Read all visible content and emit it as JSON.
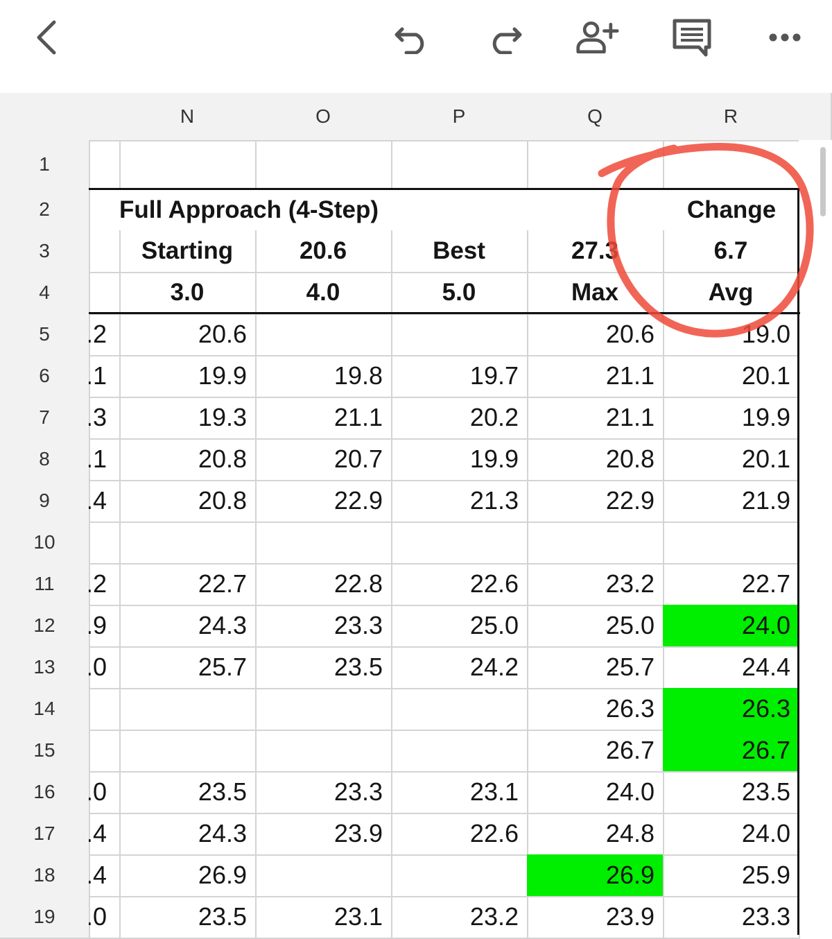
{
  "toolbar": {
    "icons": [
      "back-icon",
      "undo-icon",
      "redo-icon",
      "add-person-icon",
      "comment-icon",
      "more-icon"
    ]
  },
  "columns": [
    "N",
    "O",
    "P",
    "Q",
    "R"
  ],
  "row_numbers": [
    "1",
    "2",
    "3",
    "4",
    "5",
    "6",
    "7",
    "8",
    "9",
    "10",
    "11",
    "12",
    "13",
    "14",
    "15",
    "16",
    "17",
    "18",
    "19"
  ],
  "header": {
    "r2_title": "Full Approach (4-Step)",
    "r2_change": "Change",
    "r3": [
      "Starting",
      "20.6",
      "Best",
      "27.3",
      "6.7"
    ],
    "r4": [
      "3.0",
      "4.0",
      "5.0",
      "Max",
      "Avg"
    ]
  },
  "rows": [
    {
      "row": "5",
      "m": ".2",
      "n": "20.6",
      "o": "",
      "p": "",
      "q": "20.6",
      "r": "19.0"
    },
    {
      "row": "6",
      "m": ".1",
      "n": "19.9",
      "o": "19.8",
      "p": "19.7",
      "q": "21.1",
      "r": "20.1"
    },
    {
      "row": "7",
      "m": ".3",
      "n": "19.3",
      "o": "21.1",
      "p": "20.2",
      "q": "21.1",
      "r": "19.9"
    },
    {
      "row": "8",
      "m": ".1",
      "n": "20.8",
      "o": "20.7",
      "p": "19.9",
      "q": "20.8",
      "r": "20.1"
    },
    {
      "row": "9",
      "m": ".4",
      "n": "20.8",
      "o": "22.9",
      "p": "21.3",
      "q": "22.9",
      "r": "21.9"
    },
    {
      "row": "10",
      "m": "",
      "n": "",
      "o": "",
      "p": "",
      "q": "",
      "r": ""
    },
    {
      "row": "11",
      "m": ".2",
      "n": "22.7",
      "o": "22.8",
      "p": "22.6",
      "q": "23.2",
      "r": "22.7"
    },
    {
      "row": "12",
      "m": ".9",
      "n": "24.3",
      "o": "23.3",
      "p": "25.0",
      "q": "25.0",
      "r": "24.0"
    },
    {
      "row": "13",
      "m": ".0",
      "n": "25.7",
      "o": "23.5",
      "p": "24.2",
      "q": "25.7",
      "r": "24.4"
    },
    {
      "row": "14",
      "m": "",
      "n": "",
      "o": "",
      "p": "",
      "q": "26.3",
      "r": "26.3"
    },
    {
      "row": "15",
      "m": "",
      "n": "",
      "o": "",
      "p": "",
      "q": "26.7",
      "r": "26.7"
    },
    {
      "row": "16",
      "m": ".0",
      "n": "23.5",
      "o": "23.3",
      "p": "23.1",
      "q": "24.0",
      "r": "23.5"
    },
    {
      "row": "17",
      "m": ".4",
      "n": "24.3",
      "o": "23.9",
      "p": "22.6",
      "q": "24.8",
      "r": "24.0"
    },
    {
      "row": "18",
      "m": ".4",
      "n": "26.9",
      "o": "",
      "p": "",
      "q": "26.9",
      "r": "25.9"
    },
    {
      "row": "19",
      "m": ".0",
      "n": "23.5",
      "o": "23.1",
      "p": "23.2",
      "q": "23.9",
      "r": "23.3"
    }
  ],
  "highlights": [
    {
      "row": "12",
      "col": "R"
    },
    {
      "row": "14",
      "col": "R"
    },
    {
      "row": "15",
      "col": "R"
    },
    {
      "row": "18",
      "col": "Q"
    }
  ],
  "colors": {
    "highlight": "#00ee00",
    "annotation": "#ee4a3a",
    "header_bg": "#f2f2f2",
    "gridline": "#d4d4d4"
  }
}
